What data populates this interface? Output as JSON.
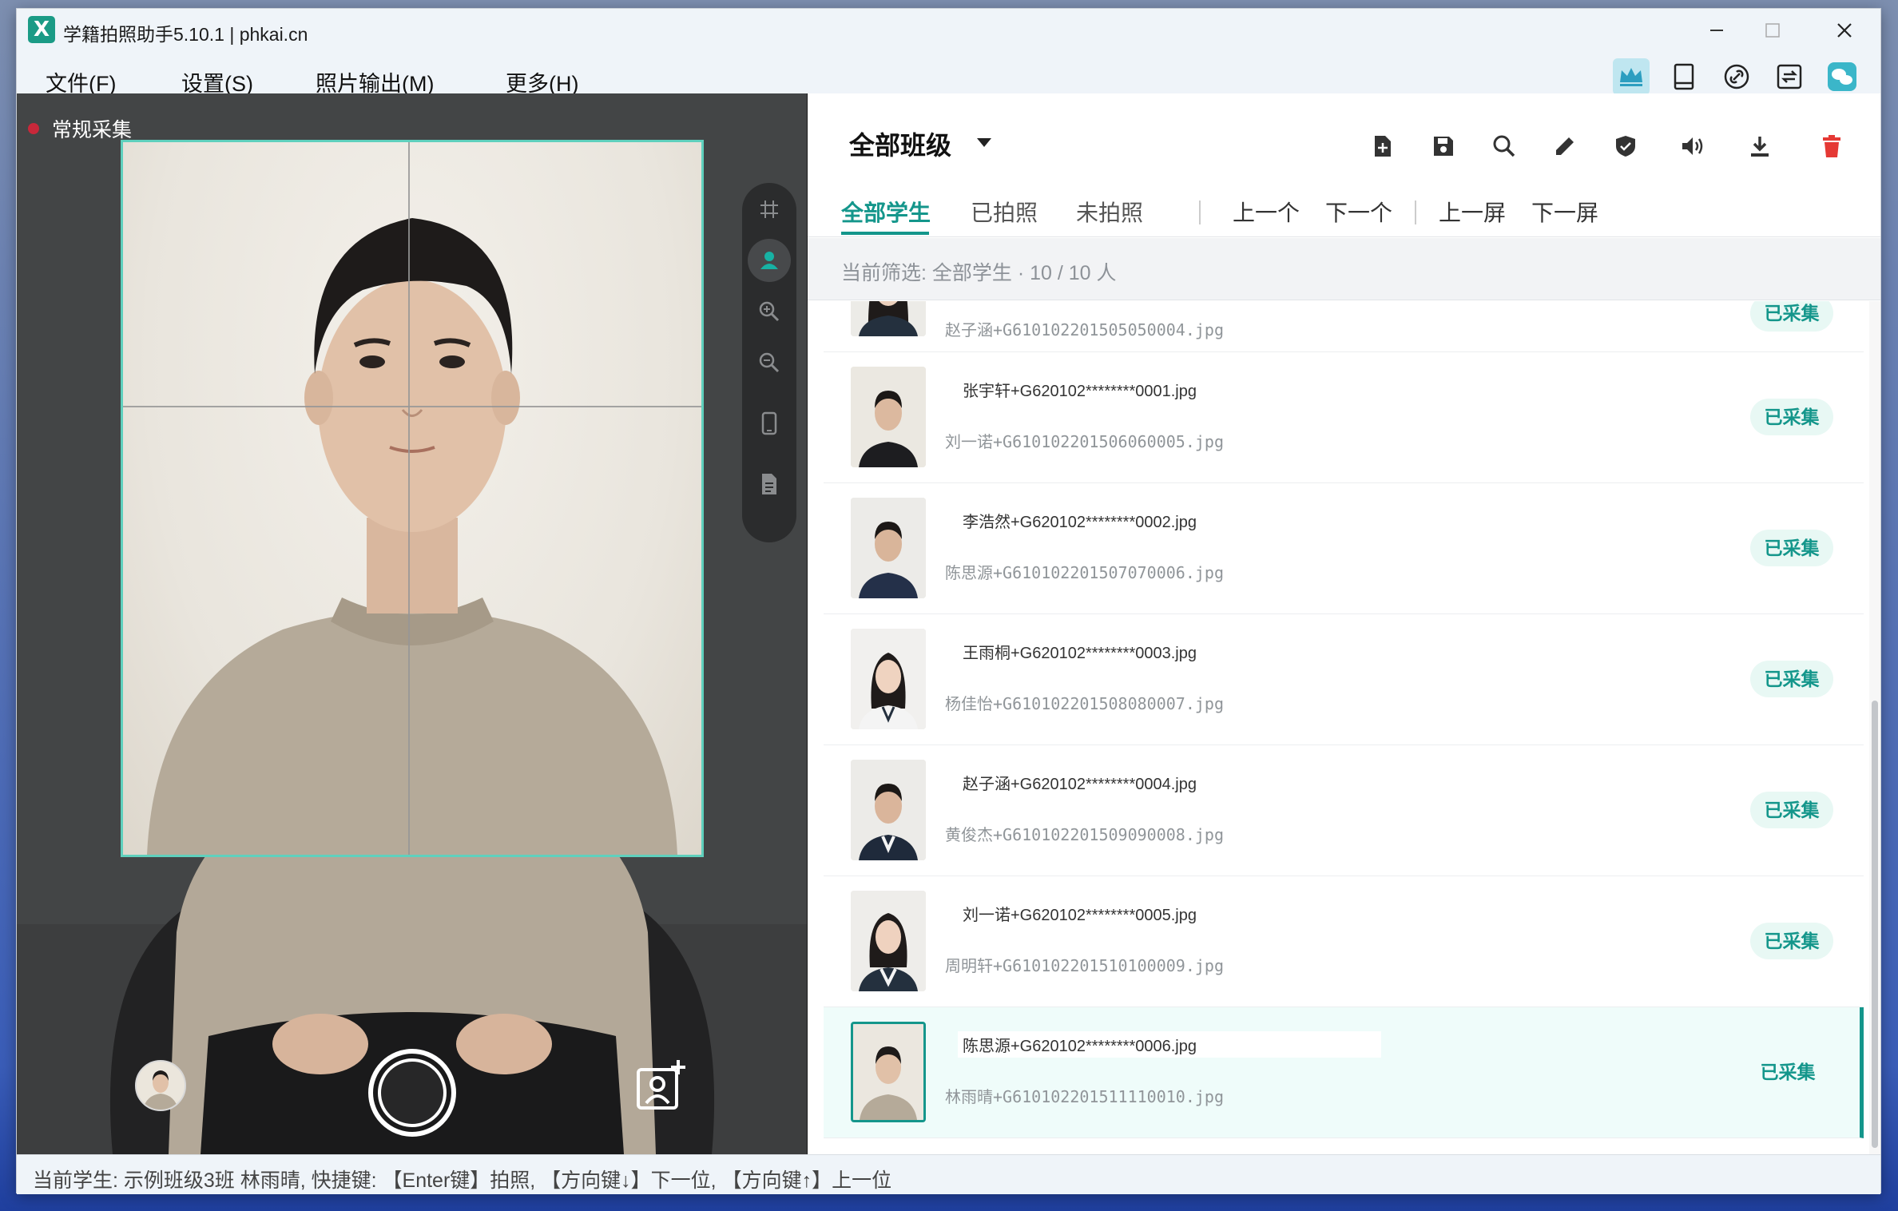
{
  "window": {
    "title": "学籍拍照助手5.10.1 | phkai.cn",
    "logo_letter": "X"
  },
  "menu": [
    "文件(F)",
    "设置(S)",
    "照片输出(M)",
    "更多(H)"
  ],
  "toolbar_icons": [
    "crown-icon",
    "tablet-icon",
    "link-icon",
    "transfer-icon",
    "wechat-icon"
  ],
  "camera": {
    "mode_label": "常规采集",
    "side_tools": [
      "grid-icon",
      "person-icon",
      "zoom-in-icon",
      "zoom-out-icon",
      "phone-icon",
      "document-icon"
    ]
  },
  "panel": {
    "class_selector": "全部班级",
    "tools": [
      "new-file-icon",
      "save-icon",
      "search-icon",
      "edit-icon",
      "shield-icon",
      "speaker-icon",
      "download-icon",
      "delete-icon"
    ],
    "tabs": [
      "全部学生",
      "已拍照",
      "未拍照"
    ],
    "nav": [
      "上一个",
      "下一个",
      "上一屏",
      "下一屏"
    ],
    "filter_text": "当前筛选: 全部学生 · 10 / 10 人"
  },
  "students": [
    {
      "name": "",
      "file": "赵子涵+G610102201505050004.jpg",
      "status": "已采集"
    },
    {
      "name": "张宇轩+G620102********0001.jpg",
      "file": "刘一诺+G610102201506060005.jpg",
      "status": "已采集"
    },
    {
      "name": "李浩然+G620102********0002.jpg",
      "file": "陈思源+G610102201507070006.jpg",
      "status": "已采集"
    },
    {
      "name": "王雨桐+G620102********0003.jpg",
      "file": "杨佳怡+G610102201508080007.jpg",
      "status": "已采集"
    },
    {
      "name": "赵子涵+G620102********0004.jpg",
      "file": "黄俊杰+G610102201509090008.jpg",
      "status": "已采集"
    },
    {
      "name": "刘一诺+G620102********0005.jpg",
      "file": "周明轩+G610102201510100009.jpg",
      "status": "已采集"
    },
    {
      "name": "陈思源+G620102********0006.jpg",
      "file": "林雨晴+G610102201511110010.jpg",
      "status": "已采集"
    }
  ],
  "status_bar": "当前学生: 示例班级3班 林雨晴, 快捷键: 【Enter键】拍照, 【方向键↓】下一位, 【方向键↑】上一位",
  "colors": {
    "accent": "#14968b",
    "frame": "#5fd0bd",
    "record": "#c8283a",
    "delete": "#e53935"
  }
}
